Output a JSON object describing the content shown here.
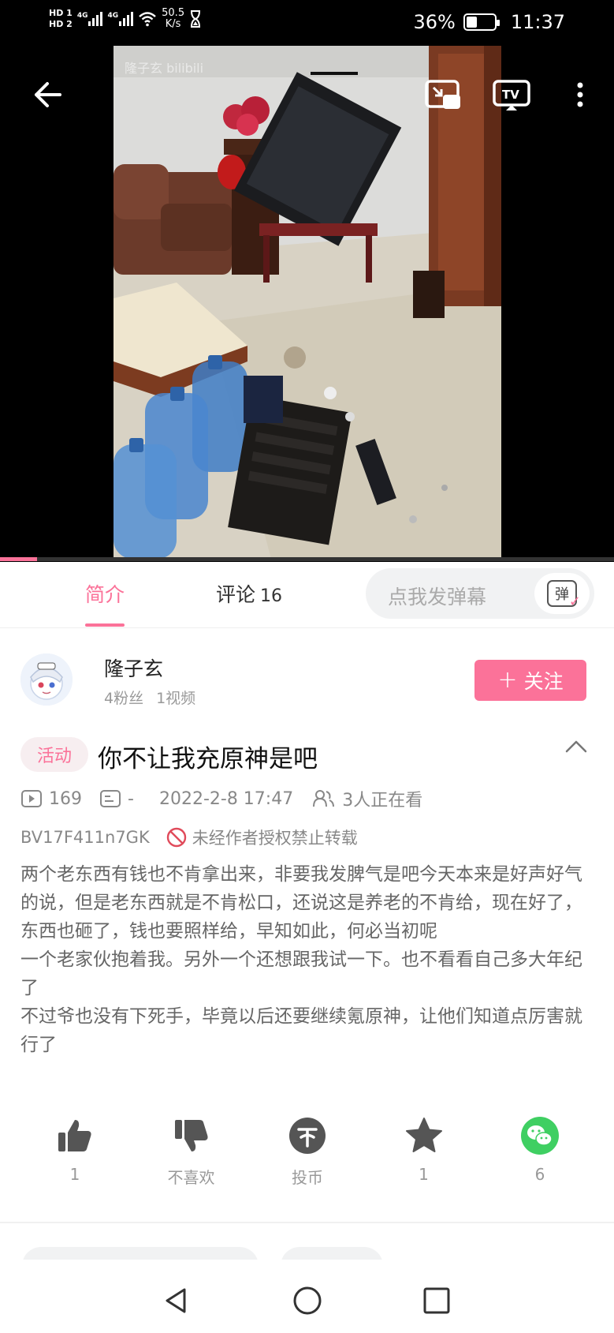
{
  "status_bar": {
    "hd1": "HD 1",
    "hd2": "HD 2",
    "net1": "4G",
    "net2": "4G",
    "speed_value": "50.5",
    "speed_unit": "K/s",
    "battery": "36%",
    "time": "11:37"
  },
  "player": {
    "watermark": "隆子玄 bilibili",
    "progress_fraction": 0.06,
    "icons": [
      "back-arrow-icon",
      "picture-in-picture-icon",
      "tv-cast-icon",
      "more-vertical-icon"
    ]
  },
  "tabs": {
    "intro": "简介",
    "comments": "评论",
    "comments_count": "16",
    "danmaku_placeholder": "点我发弹幕",
    "danmaku_btn": "弹"
  },
  "uploader": {
    "name": "隆子玄",
    "fans": "4粉丝",
    "videos": "1视频",
    "follow": "关注"
  },
  "video": {
    "badge": "活动",
    "title": "你不让我充原神是吧",
    "views": "169",
    "danmaku_count": "-",
    "date": "2022-2-8 17:47",
    "watching": "3人正在看",
    "bvid": "BV17F411n7GK",
    "copyright": "未经作者授权禁止转载",
    "description": [
      "两个老东西有钱也不肯拿出来，非要我发脾气是吧今天本来是好声好气的说，但是老东西就是不肯松口，还说这是养老的不肯给，现在好了，东西也砸了，钱也要照样给，早知如此，何必当初呢",
      "一个老家伙抱着我。另外一个还想跟我试一下。也不看看自己多大年纪了",
      "不过爷也没有下死手，毕竟以后还要继续氪原神，让他们知道点厉害就行了"
    ]
  },
  "actions": {
    "like": "1",
    "dislike": "不喜欢",
    "coin": "投币",
    "favorite": "1",
    "share": "6"
  },
  "colors": {
    "accent": "#fb7299",
    "wechat": "#3fcf62"
  }
}
